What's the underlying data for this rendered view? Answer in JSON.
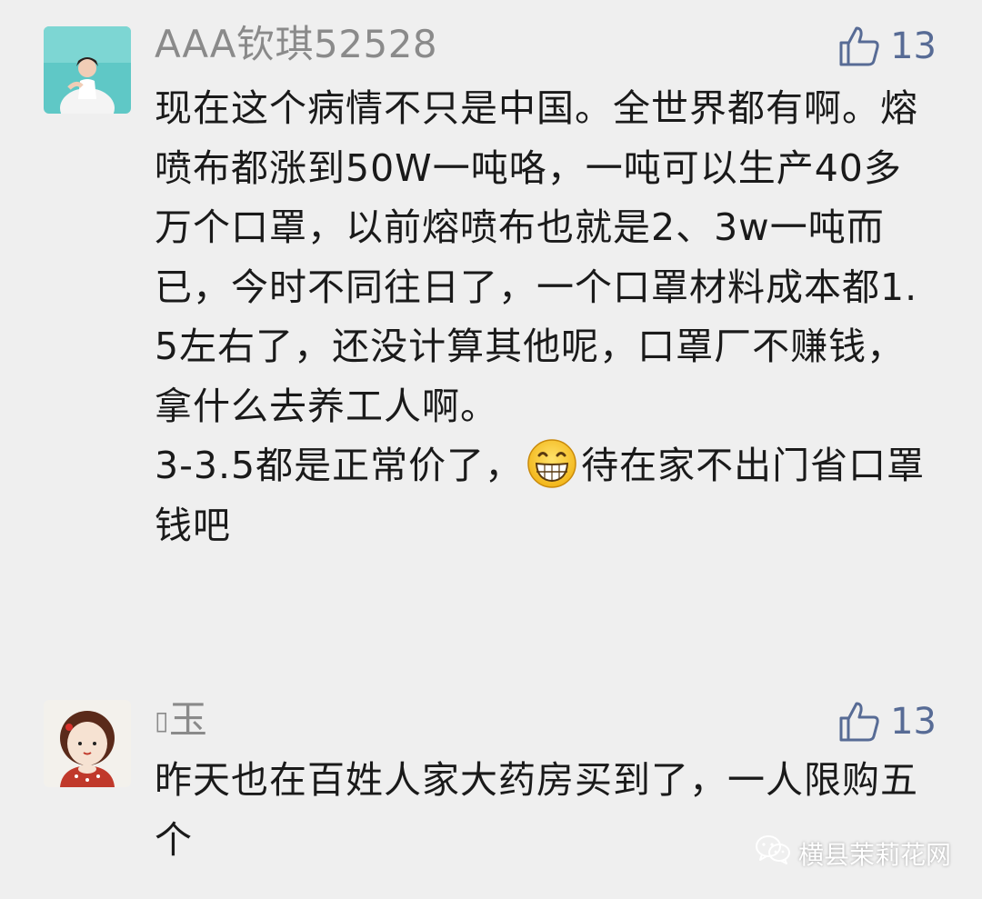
{
  "comments": [
    {
      "username": "AAA钦琪52528",
      "likes": "13",
      "avatar": "avatar-woman-photo",
      "paragraphs": [
        "现在这个病情不只是中国。全世界都有啊。熔喷布都涨到50W一吨咯，一吨可以生产40多万个口罩，以前熔喷布也就是2、3w一吨而已，今时不同往日了，一个口罩材料成本都1.5左右了，还没计算其他呢，口罩厂不赚钱，拿什么去养工人啊。"
      ],
      "last_line_before_emoji": "3-3.5都是正常价了，",
      "emoji": "grinning-face-emoji",
      "last_line_after_emoji": "待在家不出门省口罩钱吧"
    },
    {
      "username": "玉",
      "username_prefix_glyph": "▯",
      "likes": "13",
      "avatar": "avatar-cartoon-girl",
      "paragraphs": [
        "昨天也在百姓人家大药房买到了，一人限购五个"
      ]
    }
  ],
  "watermark": {
    "text": "横县茉莉花网",
    "icon": "wechat-icon"
  },
  "colors": {
    "background": "#efefef",
    "username": "#8a8a8a",
    "like": "#576b95",
    "text": "#1a1a1a"
  }
}
